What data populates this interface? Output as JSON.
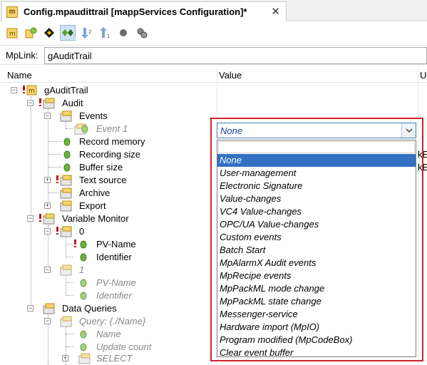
{
  "tab": {
    "icon_text": "m",
    "title": "Config.mpaudittrail [mappServices Configuration]*",
    "close": "✕"
  },
  "toolbar": {
    "buttons": [
      "config-icon",
      "add-icon",
      "navigate-icon",
      "diamond-active-icon",
      "move-down-icon",
      "move-up-icon",
      "circle-icon",
      "gears-icon"
    ]
  },
  "mplink": {
    "label": "MpLink:",
    "value": "gAuditTrail"
  },
  "columns": {
    "name": "Name",
    "value": "Value",
    "unit": "U"
  },
  "tree": {
    "root": "gAuditTrail",
    "audit": "Audit",
    "events": "Events",
    "event1": "Event 1",
    "record_memory": "Record memory",
    "recording_size": "Recording size",
    "buffer_size": "Buffer size",
    "text_source": "Text source",
    "archive": "Archive",
    "export": "Export",
    "variable_monitor": "Variable Monitor",
    "vm_0": "0",
    "pv_name": "PV-Name",
    "identifier": "Identifier",
    "vm_1": "1",
    "pv_name_2": "PV-Name",
    "identifier_2": "Identifier",
    "data_queries": "Data Queries",
    "query": "Query: {./Name}",
    "name": "Name",
    "update_count": "Update count",
    "select": "SELECT"
  },
  "partial_values": {
    "recording_size": "kE",
    "buffer_size": "kE"
  },
  "dropdown": {
    "current": "None",
    "options": [
      "None",
      "User-management",
      "Electronic Signature",
      "Value-changes",
      "VC4 Value-changes",
      "OPC/UA Value-changes",
      "Custom events",
      "Batch Start",
      "MpAlarmX Audit events",
      "MpRecipe events",
      "MpPackML mode change",
      "MpPackML state change",
      "Messenger-service",
      "Hardware import (MpIO)",
      "Program modified (MpCodeBox)",
      "Clear event buffer"
    ],
    "selected_index": 0
  },
  "colors": {
    "accent": "#3271c1",
    "highlight_border": "#d2232a",
    "required": "#c2141b"
  }
}
